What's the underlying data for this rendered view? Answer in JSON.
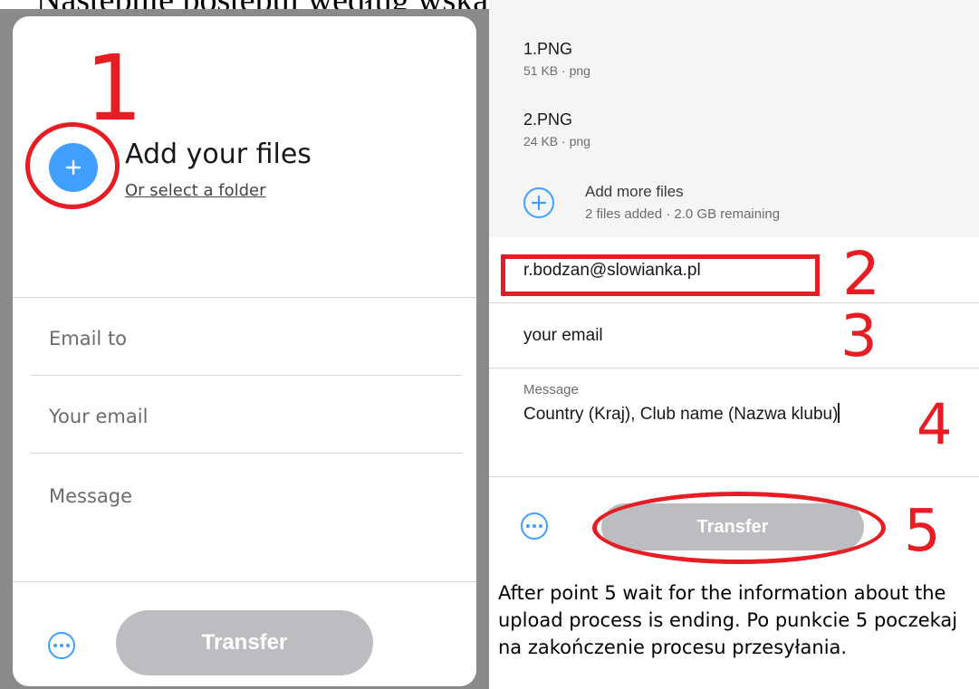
{
  "heading": {
    "text": "Następnie postępuj według wskazówek:"
  },
  "left": {
    "add_title": "Add your files",
    "select_folder": "Or select a folder",
    "email_to": "Email to",
    "your_email": "Your email",
    "message": "Message",
    "transfer": "Transfer"
  },
  "right": {
    "files": [
      {
        "name": "1.PNG",
        "meta": "51 KB · png"
      },
      {
        "name": "2.PNG",
        "meta": "24 KB · png"
      }
    ],
    "add_more_title": "Add more files",
    "add_more_sub": "2 files added · 2.0 GB remaining",
    "email_to_value": "r.bodzan@slowianka.pl",
    "your_email": "your email",
    "message_label": "Message",
    "message_value": "Country (Kraj),  Club name (Nazwa klubu)",
    "transfer": "Transfer"
  },
  "annotations": {
    "n1": "1",
    "n2": "2",
    "n3": "3",
    "n4": "4",
    "n5": "5"
  },
  "instructions": "After point 5 wait for the information about the upload process is ending. Po punkcie 5 poczekaj na zakończenie procesu przesyłania.",
  "colors": {
    "accent": "#409fff",
    "annotation": "#e81d24",
    "disabled_button": "#bcbdc1"
  }
}
